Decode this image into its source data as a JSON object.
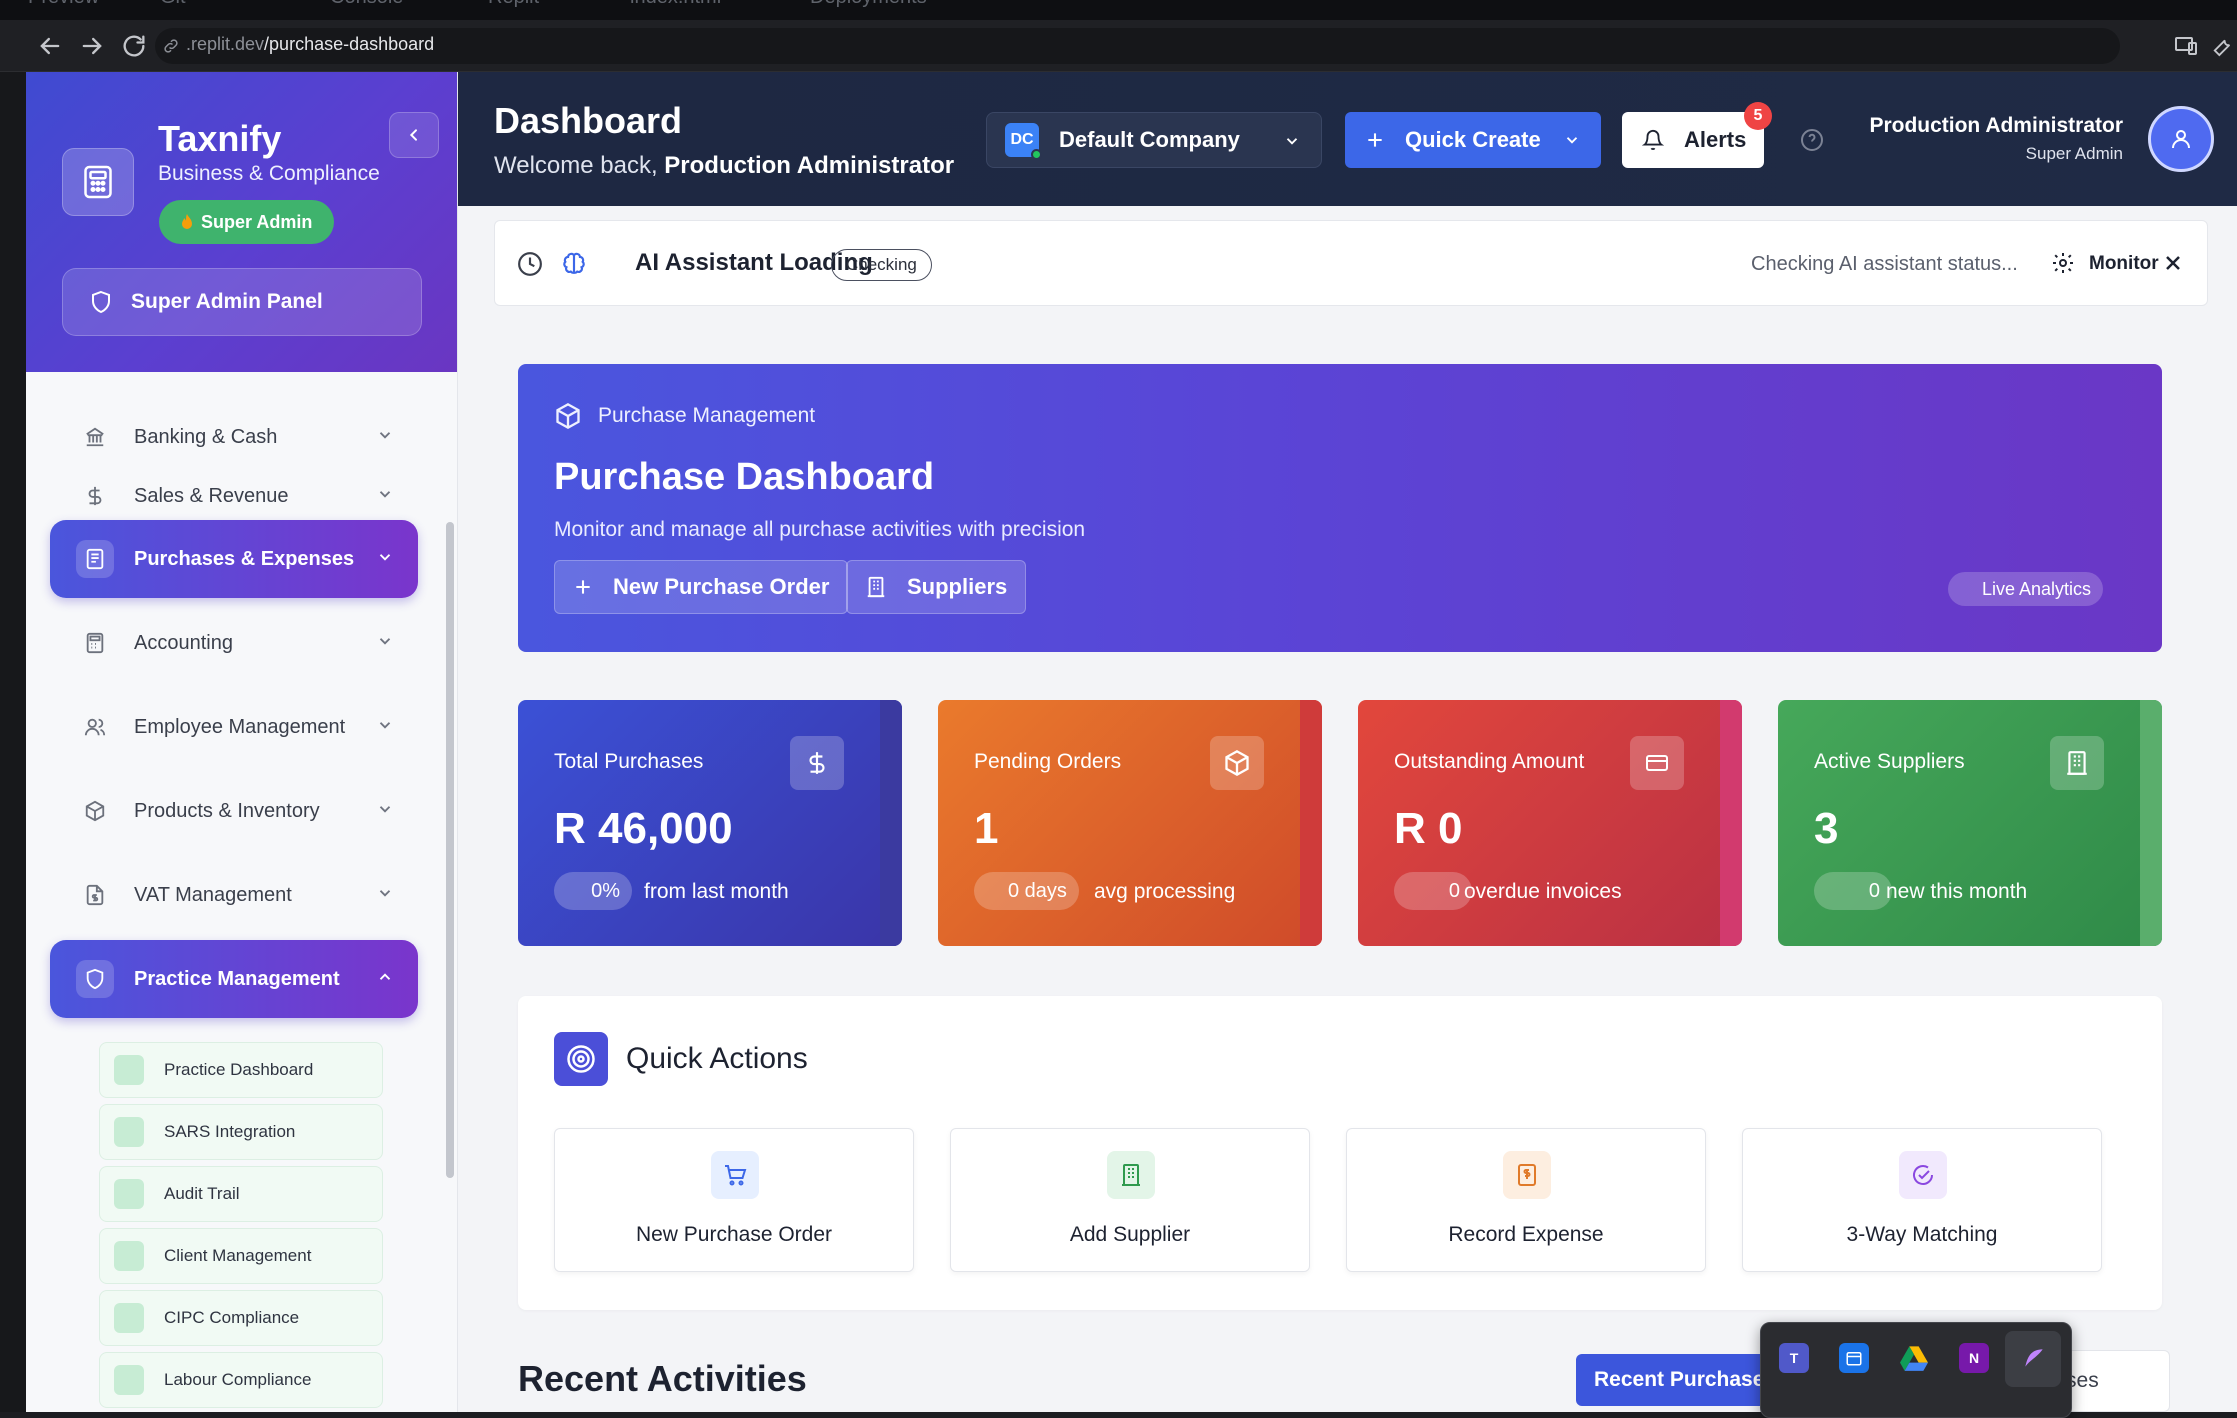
{
  "browser": {
    "tabs": [
      "Preview",
      "Git",
      "Console",
      "Replit",
      "index.html",
      "Deployments"
    ],
    "url_host": ".replit.dev",
    "url_path": "/purchase-dashboard"
  },
  "sidebar": {
    "brand": "Taxnify",
    "brand_sub": "Business & Compliance",
    "role_badge": "Super Admin",
    "panel_button": "Super Admin Panel",
    "items": [
      {
        "label": "Banking & Cash",
        "icon": "bank-icon",
        "active": false
      },
      {
        "label": "Sales & Revenue",
        "icon": "dollar-icon",
        "active": false
      },
      {
        "label": "Purchases & Expenses",
        "icon": "receipt-icon",
        "active": true
      },
      {
        "label": "Accounting",
        "icon": "calculator-icon",
        "active": false
      },
      {
        "label": "Employee Management",
        "icon": "users-icon",
        "active": false
      },
      {
        "label": "Products & Inventory",
        "icon": "package-icon",
        "active": false
      },
      {
        "label": "VAT Management",
        "icon": "file-dollar-icon",
        "active": false
      },
      {
        "label": "Practice Management",
        "icon": "shield-icon",
        "active": true
      }
    ],
    "sub_items": [
      "Practice Dashboard",
      "SARS Integration",
      "Audit Trail",
      "Client Management",
      "CIPC Compliance",
      "Labour Compliance"
    ]
  },
  "header": {
    "title": "Dashboard",
    "welcome_prefix": "Welcome back,",
    "welcome_name": "Production Administrator",
    "company_initials": "DC",
    "company_name": "Default Company",
    "quick_create": "Quick Create",
    "alerts": "Alerts",
    "alerts_count": "5",
    "user_name": "Production Administrator",
    "user_role": "Super Admin"
  },
  "ai_bar": {
    "title": "AI Assistant Loading",
    "pill": "Checking",
    "status": "Checking AI assistant status...",
    "monitor": "Monitor"
  },
  "hero": {
    "tag": "Purchase Management",
    "title": "Purchase Dashboard",
    "description": "Monitor and manage all purchase activities with precision",
    "btn_new_po": "New Purchase Order",
    "btn_suppliers": "Suppliers",
    "live": "Live Analytics"
  },
  "stats": [
    {
      "label": "Total Purchases",
      "value": "R 46,000",
      "pill": "0%",
      "note": "from last month",
      "color_from": "#3b51d6",
      "color_to": "#3a35a8",
      "edge": "#3b3aa0"
    },
    {
      "label": "Pending Orders",
      "value": "1",
      "pill": "0 days",
      "note": "avg processing",
      "color_from": "#ea7a2c",
      "color_to": "#cf4a2a",
      "edge": "#cf3b3a"
    },
    {
      "label": "Outstanding Amount",
      "value": "R 0",
      "pill": "0",
      "note": "overdue invoices",
      "color_from": "#e2473c",
      "color_to": "#b93044",
      "edge": "#d23a6e"
    },
    {
      "label": "Active Suppliers",
      "value": "3",
      "pill": "0",
      "note": "new this month",
      "color_from": "#46a85a",
      "color_to": "#2f8a48",
      "edge": "#5aae6c"
    }
  ],
  "quick_actions": {
    "title": "Quick Actions",
    "items": [
      {
        "label": "New Purchase Order",
        "icon": "cart-icon",
        "bg": "#e6efff",
        "fg": "#3c67e8"
      },
      {
        "label": "Add Supplier",
        "icon": "building-icon",
        "bg": "#e3f5e8",
        "fg": "#2f9a4e"
      },
      {
        "label": "Record Expense",
        "icon": "receipt-icon",
        "bg": "#fdeee0",
        "fg": "#e07a2a"
      },
      {
        "label": "3-Way Matching",
        "icon": "check-circle-icon",
        "bg": "#f1e9fd",
        "fg": "#8a48e0"
      }
    ]
  },
  "recent": {
    "title": "Recent Activities",
    "tab_active": "Recent Purchase",
    "tab_other": "penses"
  }
}
